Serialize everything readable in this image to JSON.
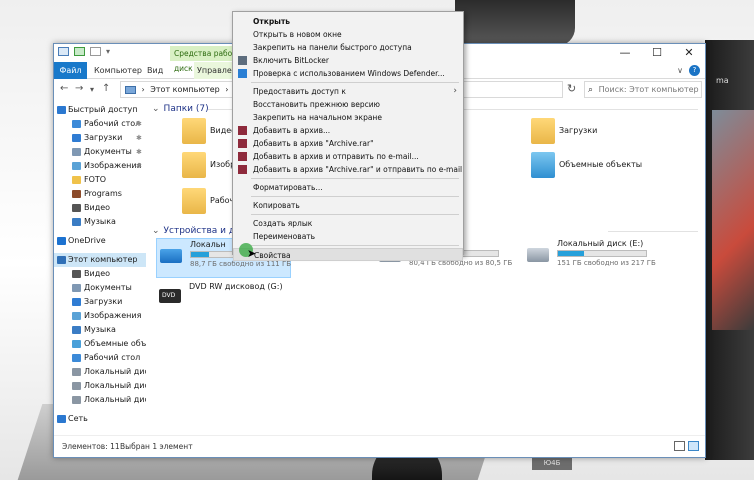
{
  "window": {
    "context_tab_header": "Средства работы с диск",
    "tabs": {
      "file": "Файл",
      "computer": "Компьютер",
      "view": "Вид",
      "manage": "Управление"
    },
    "address_path": "Этот компьютер",
    "address_sep": "›",
    "search_placeholder": "Поиск: Этот компьютер",
    "controls": {
      "minimize": "—",
      "maximize": "☐",
      "close": "✕"
    },
    "nav_glyphs": {
      "back": "←",
      "forward": "→",
      "recent": "▾",
      "up": "↑",
      "refresh": "↻",
      "ribbon_expand": "∨",
      "help": "?"
    }
  },
  "sidebar": {
    "items": [
      {
        "label": "Быстрый доступ",
        "level": 0,
        "pinned": false,
        "color": "#2b78d0"
      },
      {
        "label": "Рабочий стол",
        "level": 1,
        "pinned": true,
        "color": "#3c8ad8"
      },
      {
        "label": "Загрузки",
        "level": 1,
        "pinned": true,
        "color": "#2f7cd3"
      },
      {
        "label": "Документы",
        "level": 1,
        "pinned": true,
        "color": "#7f98b3"
      },
      {
        "label": "Изображения",
        "level": 1,
        "pinned": true,
        "color": "#5aa2d6"
      },
      {
        "label": "FOTO",
        "level": 1,
        "pinned": false,
        "color": "#f0c24a"
      },
      {
        "label": "Programs",
        "level": 1,
        "pinned": false,
        "color": "#8c4b2a"
      },
      {
        "label": "Видео",
        "level": 1,
        "pinned": false,
        "color": "#555555"
      },
      {
        "label": "Музыка",
        "level": 1,
        "pinned": false,
        "color": "#3a7cc4"
      },
      {
        "label": "OneDrive",
        "level": 0,
        "pinned": false,
        "color": "#1c72d0"
      },
      {
        "label": "Этот компьютер",
        "level": 0,
        "pinned": false,
        "color": "#2f6fb6",
        "selected": true
      },
      {
        "label": "Видео",
        "level": 1,
        "pinned": false,
        "color": "#555555"
      },
      {
        "label": "Документы",
        "level": 1,
        "pinned": false,
        "color": "#7f98b3"
      },
      {
        "label": "Загрузки",
        "level": 1,
        "pinned": false,
        "color": "#2f7cd3"
      },
      {
        "label": "Изображения",
        "level": 1,
        "pinned": false,
        "color": "#5aa2d6"
      },
      {
        "label": "Музыка",
        "level": 1,
        "pinned": false,
        "color": "#3a7cc4"
      },
      {
        "label": "Объемные объекты",
        "level": 1,
        "pinned": false,
        "color": "#4aa0d9"
      },
      {
        "label": "Рабочий стол",
        "level": 1,
        "pinned": false,
        "color": "#3c8ad8"
      },
      {
        "label": "Локальный диск (C",
        "level": 1,
        "pinned": false,
        "color": "#8a96a3"
      },
      {
        "label": "Локальный диск (D",
        "level": 1,
        "pinned": false,
        "color": "#8a96a3"
      },
      {
        "label": "Локальный диск (E",
        "level": 1,
        "pinned": false,
        "color": "#8a96a3"
      },
      {
        "label": "Сеть",
        "level": 0,
        "pinned": false,
        "color": "#2b78d0"
      }
    ],
    "pin_glyph": "✱"
  },
  "content": {
    "folders_header": "Папки (7)",
    "devices_header": "Устройства и диски",
    "section_chevron": "⌄",
    "folders": [
      {
        "label": "Видео"
      },
      {
        "label": "Изобра"
      },
      {
        "label": "Рабочи"
      },
      {
        "label": "Загрузки"
      },
      {
        "label": "Объемные объекты"
      }
    ],
    "drives": [
      {
        "name": "Локальн",
        "free": "88,7 ГБ свободно из 111 ГБ",
        "used_fraction": 0.2
      },
      {
        "name": "",
        "free": "80,4 ГБ свободно из 80,5 ГБ",
        "used_fraction": 0.01
      },
      {
        "name": "Локальный диск (E:)",
        "free": "151 ГБ свободно из 217 ГБ",
        "used_fraction": 0.3
      }
    ],
    "dvd": {
      "name": "DVD RW дисковод (G:)",
      "icon_text": "DVD"
    }
  },
  "context_menu": {
    "items": [
      {
        "label": "Открыть",
        "bold": true,
        "icon": ""
      },
      {
        "label": "Открыть в новом окне",
        "icon": ""
      },
      {
        "label": "Закрепить на панели быстрого доступа",
        "icon": ""
      },
      {
        "label": "Включить BitLocker",
        "icon": "shield-icon",
        "icon_color": "#5d6d7e"
      },
      {
        "label": "Проверка с использованием Windows Defender...",
        "icon": "defender-icon",
        "icon_color": "#2a7fd4"
      },
      {
        "sep": true
      },
      {
        "label": "Предоставить доступ к",
        "icon": "",
        "submenu": true
      },
      {
        "label": "Восстановить прежнюю версию",
        "icon": ""
      },
      {
        "label": "Закрепить на начальном экране",
        "icon": ""
      },
      {
        "label": "Добавить в архив...",
        "icon": "winrar-icon",
        "icon_color": "#8e2a3c"
      },
      {
        "label": "Добавить в архив \"Archive.rar\"",
        "icon": "winrar-icon",
        "icon_color": "#8e2a3c"
      },
      {
        "label": "Добавить в архив и отправить по e-mail...",
        "icon": "winrar-icon",
        "icon_color": "#8e2a3c"
      },
      {
        "label": "Добавить в архив \"Archive.rar\" и отправить по e-mail",
        "icon": "winrar-icon",
        "icon_color": "#8e2a3c"
      },
      {
        "sep": true
      },
      {
        "label": "Форматировать...",
        "icon": ""
      },
      {
        "sep": true
      },
      {
        "label": "Копировать",
        "icon": ""
      },
      {
        "sep": true
      },
      {
        "label": "Создать ярлык",
        "icon": ""
      },
      {
        "label": "Переименовать",
        "icon": ""
      },
      {
        "sep": true
      },
      {
        "label": "Свойства",
        "icon": "",
        "highlighted": true
      }
    ],
    "submenu_arrow": "›"
  },
  "statusbar": {
    "count": "Элементов: 11",
    "selected": "Выбран 1 элемент"
  },
  "background": {
    "laptop_label": "ma",
    "brand": "Ю4Б"
  },
  "colors": {
    "accent": "#1979ca",
    "selection": "#cce8ff",
    "folder": "#f0c24a",
    "drive_bar": "#26a0da",
    "section_title": "#1e3287"
  }
}
